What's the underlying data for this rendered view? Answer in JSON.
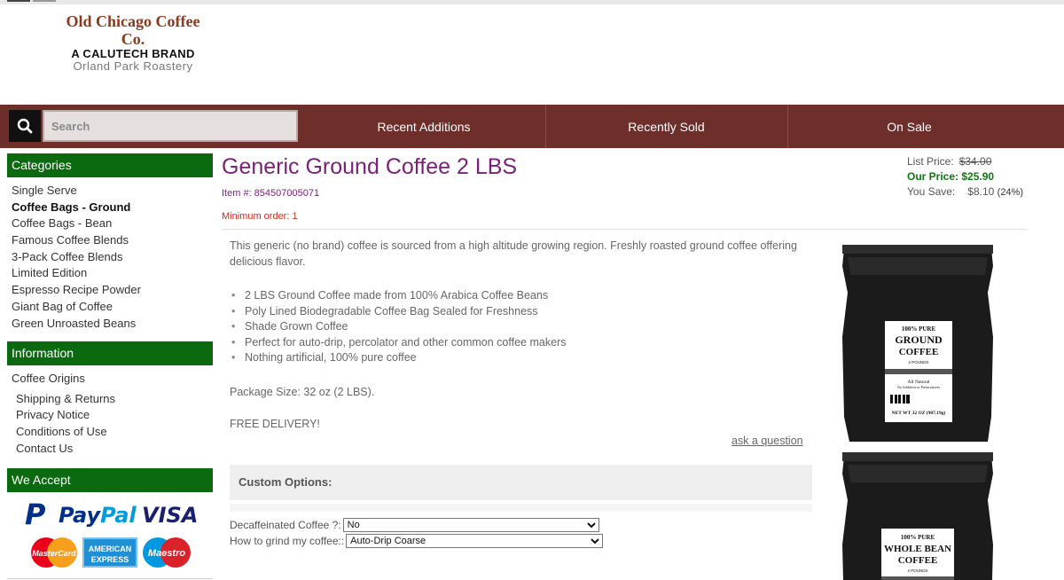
{
  "logo": {
    "line1": "Old Chicago Coffee Co.",
    "line2": "A CALUTECH BRAND",
    "line3": "Orland Park Roastery"
  },
  "navbar": {
    "search_placeholder": "Search",
    "links": [
      "Recent Additions",
      "Recently Sold",
      "On Sale"
    ]
  },
  "sidebar": {
    "categories_title": "Categories",
    "categories": [
      "Single Serve",
      "Coffee Bags - Ground",
      "Coffee Bags - Bean",
      "Famous Coffee Blends",
      "3-Pack Coffee Blends",
      "Limited Edition",
      "Espresso Recipe Powder",
      "Giant Bag of Coffee",
      "Green Unroasted Beans"
    ],
    "active_category": "Coffee Bags - Ground",
    "information_title": "Information",
    "information": [
      "Coffee Origins",
      "Shipping & Returns",
      "Privacy Notice",
      "Conditions of Use",
      "Contact Us"
    ],
    "accept_title": "We Accept",
    "payment": {
      "paypal_a": "Pay",
      "paypal_b": "Pal",
      "visa": "VISA",
      "mastercard": "MasterCard",
      "amex_1": "AMERICAN",
      "amex_2": "EXPRESS",
      "maestro": "Maestro"
    }
  },
  "product": {
    "title": "Generic Ground Coffee 2 LBS",
    "item_number": "Item #: 854507005071",
    "min_order": "Minimum order: 1",
    "description": "This generic (no brand) coffee is sourced from a high altitude growing region. Freshly roasted ground coffee offering delicious flavor.",
    "bullets": [
      "2 LBS Ground Coffee made from 100% Arabica Coffee Beans",
      "Poly Lined Biodegradable Coffee Bag Sealed for Freshness",
      "Shade Grown Coffee",
      "Perfect for auto-drip, percolator and other common coffee makers",
      "Nothing artificial, 100% pure coffee"
    ],
    "package_size": "Package Size: 32 oz (2 LBS).",
    "free_delivery": "FREE DELIVERY!",
    "ask_question": "ask a question"
  },
  "pricing": {
    "list_label": "List Price:",
    "list_value": "$34.00",
    "our_label": "Our Price:",
    "our_value": "$25.90",
    "save_label": "You Save:",
    "save_value": "$8.10",
    "save_pct": "(24%)"
  },
  "options": {
    "header": "Custom Options:",
    "decaf_label": "Decaffeinated Coffee ?:",
    "decaf_value": "No",
    "grind_label": "How to grind my coffee::",
    "grind_value": "Auto-Drip Coarse"
  },
  "bag1": {
    "l1": "100% PURE",
    "l2": "GROUND",
    "l3": "COFFEE",
    "l4": "2 POUNDS",
    "l5": "All Natural",
    "l6": "No Additives or Preservatives",
    "l7": "NET WT 32 OZ (907.19g)"
  },
  "bag2": {
    "l1": "100% PURE",
    "l2": "WHOLE BEAN",
    "l3": "COFFEE",
    "l4": "2 POUNDS"
  },
  "colors": {
    "nav_bg": "#6e2f2b",
    "sidebar_head": "#0b6a0f",
    "title": "#7b1f7b",
    "our_price": "#0b7a0b",
    "min_order": "#c62f1b"
  }
}
